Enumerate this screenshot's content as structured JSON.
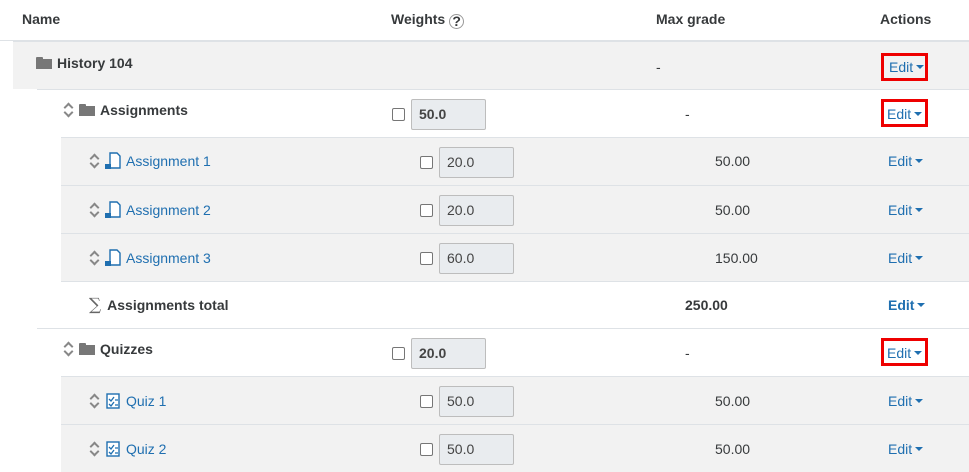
{
  "header": {
    "name": "Name",
    "weights": "Weights",
    "help_glyph": "?",
    "max_grade": "Max grade",
    "actions": "Actions"
  },
  "course": {
    "name": "History 104",
    "max_grade": "-",
    "edit": "Edit"
  },
  "assignments_cat": {
    "name": "Assignments",
    "weight": "50.0",
    "max_grade": "-",
    "edit": "Edit"
  },
  "assignment_items": [
    {
      "name": "Assignment 1",
      "weight": "20.0",
      "max_grade": "50.00",
      "edit": "Edit"
    },
    {
      "name": "Assignment 2",
      "weight": "20.0",
      "max_grade": "50.00",
      "edit": "Edit"
    },
    {
      "name": "Assignment 3",
      "weight": "60.0",
      "max_grade": "150.00",
      "edit": "Edit"
    }
  ],
  "assignments_total": {
    "name": "Assignments total",
    "max_grade": "250.00",
    "edit": "Edit"
  },
  "quizzes_cat": {
    "name": "Quizzes",
    "weight": "20.0",
    "max_grade": "-",
    "edit": "Edit"
  },
  "quiz_items": [
    {
      "name": "Quiz 1",
      "weight": "50.0",
      "max_grade": "50.00",
      "edit": "Edit"
    },
    {
      "name": "Quiz 2",
      "weight": "50.0",
      "max_grade": "50.00",
      "edit": "Edit"
    }
  ],
  "colors": {
    "link": "#1f6fb0",
    "highlight": "#e00000",
    "row_grey": "#f2f2f2"
  }
}
